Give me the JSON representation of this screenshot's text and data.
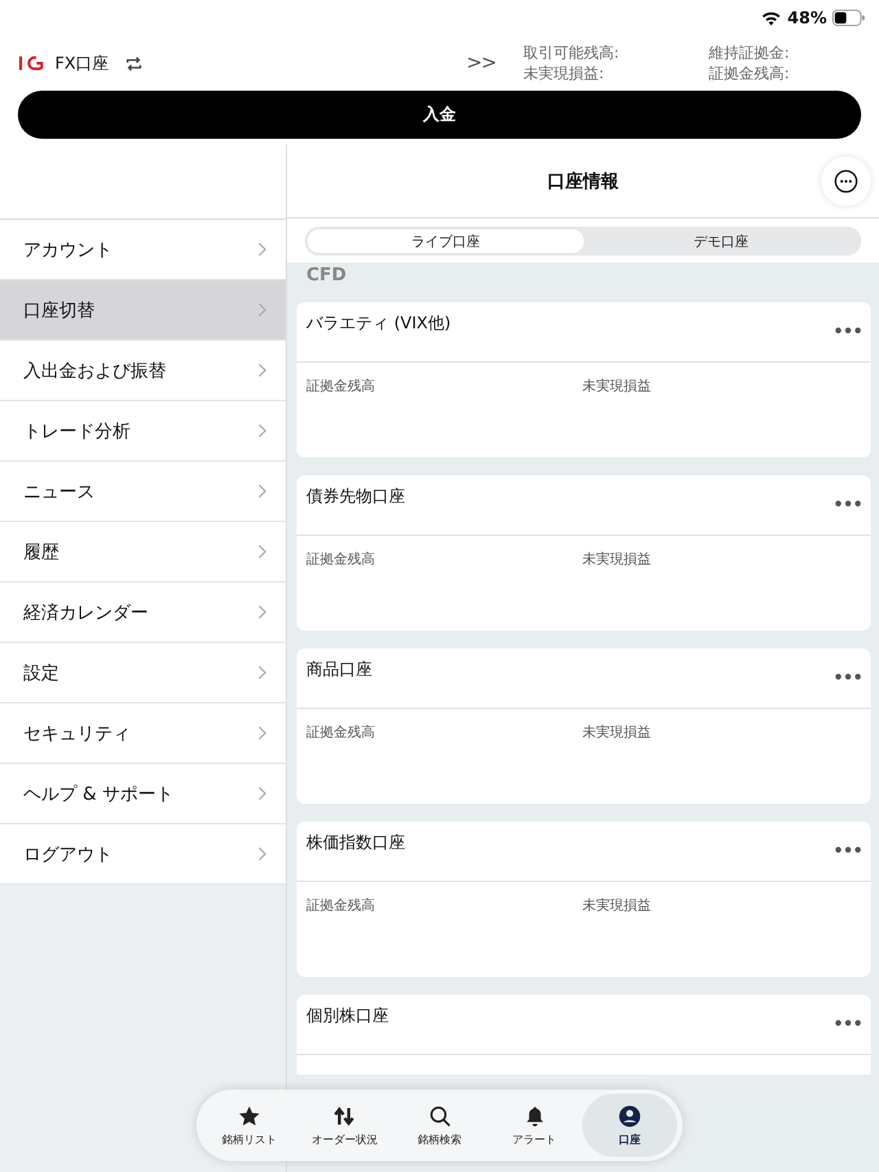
{
  "status_bar": {
    "battery": "48%"
  },
  "header": {
    "account": "FX口座",
    "expand": ">>",
    "summary": [
      "取引可能残高:",
      "維持証拠金:",
      "未実現損益:",
      "証拠金残高:"
    ]
  },
  "deposit_button": "入金",
  "sidebar": {
    "items": [
      {
        "label": "アカウント",
        "selected": false
      },
      {
        "label": "口座切替",
        "selected": true
      },
      {
        "label": "入出金および振替",
        "selected": false
      },
      {
        "label": "トレード分析",
        "selected": false
      },
      {
        "label": "ニュース",
        "selected": false
      },
      {
        "label": "履歴",
        "selected": false
      },
      {
        "label": "経済カレンダー",
        "selected": false
      },
      {
        "label": "設定",
        "selected": false
      },
      {
        "label": "セキュリティ",
        "selected": false
      },
      {
        "label": "ヘルプ & サポート",
        "selected": false
      },
      {
        "label": "ログアウト",
        "selected": false
      }
    ]
  },
  "panel": {
    "title": "口座情報",
    "segments": [
      {
        "label": "ライブ口座",
        "selected": true
      },
      {
        "label": "デモ口座",
        "selected": false
      }
    ],
    "section": "CFD",
    "cards": [
      {
        "title": "バラエティ (VIX他)",
        "fields": [
          "証拠金残高",
          "未実現損益"
        ]
      },
      {
        "title": "債券先物口座",
        "fields": [
          "証拠金残高",
          "未実現損益"
        ]
      },
      {
        "title": "商品口座",
        "fields": [
          "証拠金残高",
          "未実現損益"
        ]
      },
      {
        "title": "株価指数口座",
        "fields": [
          "証拠金残高",
          "未実現損益"
        ]
      },
      {
        "title": "個別株口座"
      }
    ]
  },
  "tab_bar": [
    {
      "label": "銘柄リスト",
      "kind": "star",
      "selected": false
    },
    {
      "label": "オーダー状況",
      "kind": "arrows",
      "selected": false
    },
    {
      "label": "銘柄検索",
      "kind": "search",
      "selected": false
    },
    {
      "label": "アラート",
      "kind": "bell",
      "selected": false
    },
    {
      "label": "口座",
      "kind": "account",
      "selected": true
    }
  ]
}
